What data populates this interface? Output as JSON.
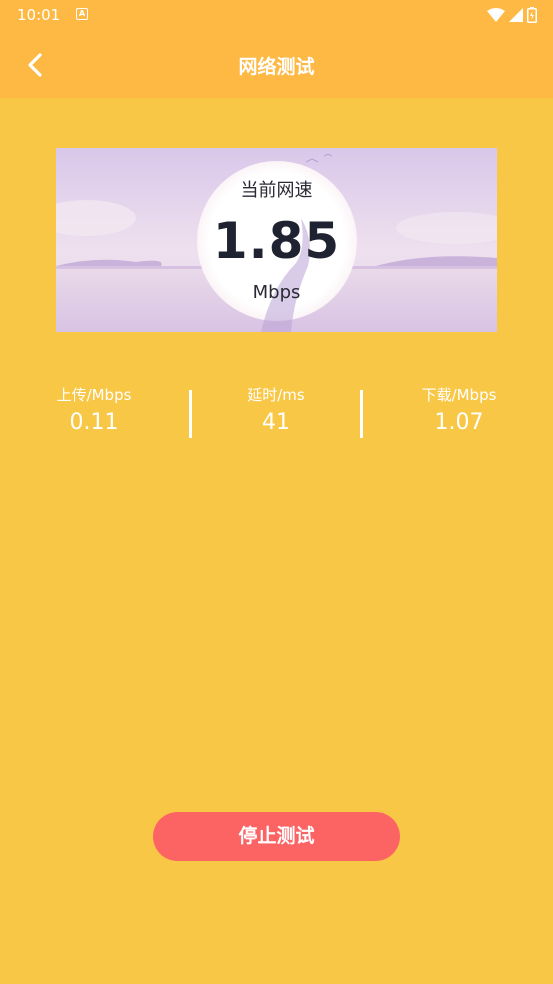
{
  "status_bar": {
    "time": "10:01",
    "notification_icon_letter": "A",
    "icons": [
      "wifi-icon",
      "signal-icon",
      "battery-icon"
    ]
  },
  "header": {
    "title": "网络测试",
    "back_icon": "chevron-left-icon"
  },
  "speed_card": {
    "label": "当前网速",
    "value": "1.85",
    "unit": "Mbps"
  },
  "stats": {
    "upload": {
      "label": "上传/Mbps",
      "value": "0.11"
    },
    "latency": {
      "label": "延时/ms",
      "value": "41"
    },
    "download": {
      "label": "下载/Mbps",
      "value": "1.07"
    }
  },
  "actions": {
    "stop_label": "停止测试"
  },
  "colors": {
    "background": "#F9C746",
    "header": "#FDB944",
    "stop_button": "#FC6464",
    "text_light": "#FFFFFF",
    "speed_text": "#1F2230"
  }
}
